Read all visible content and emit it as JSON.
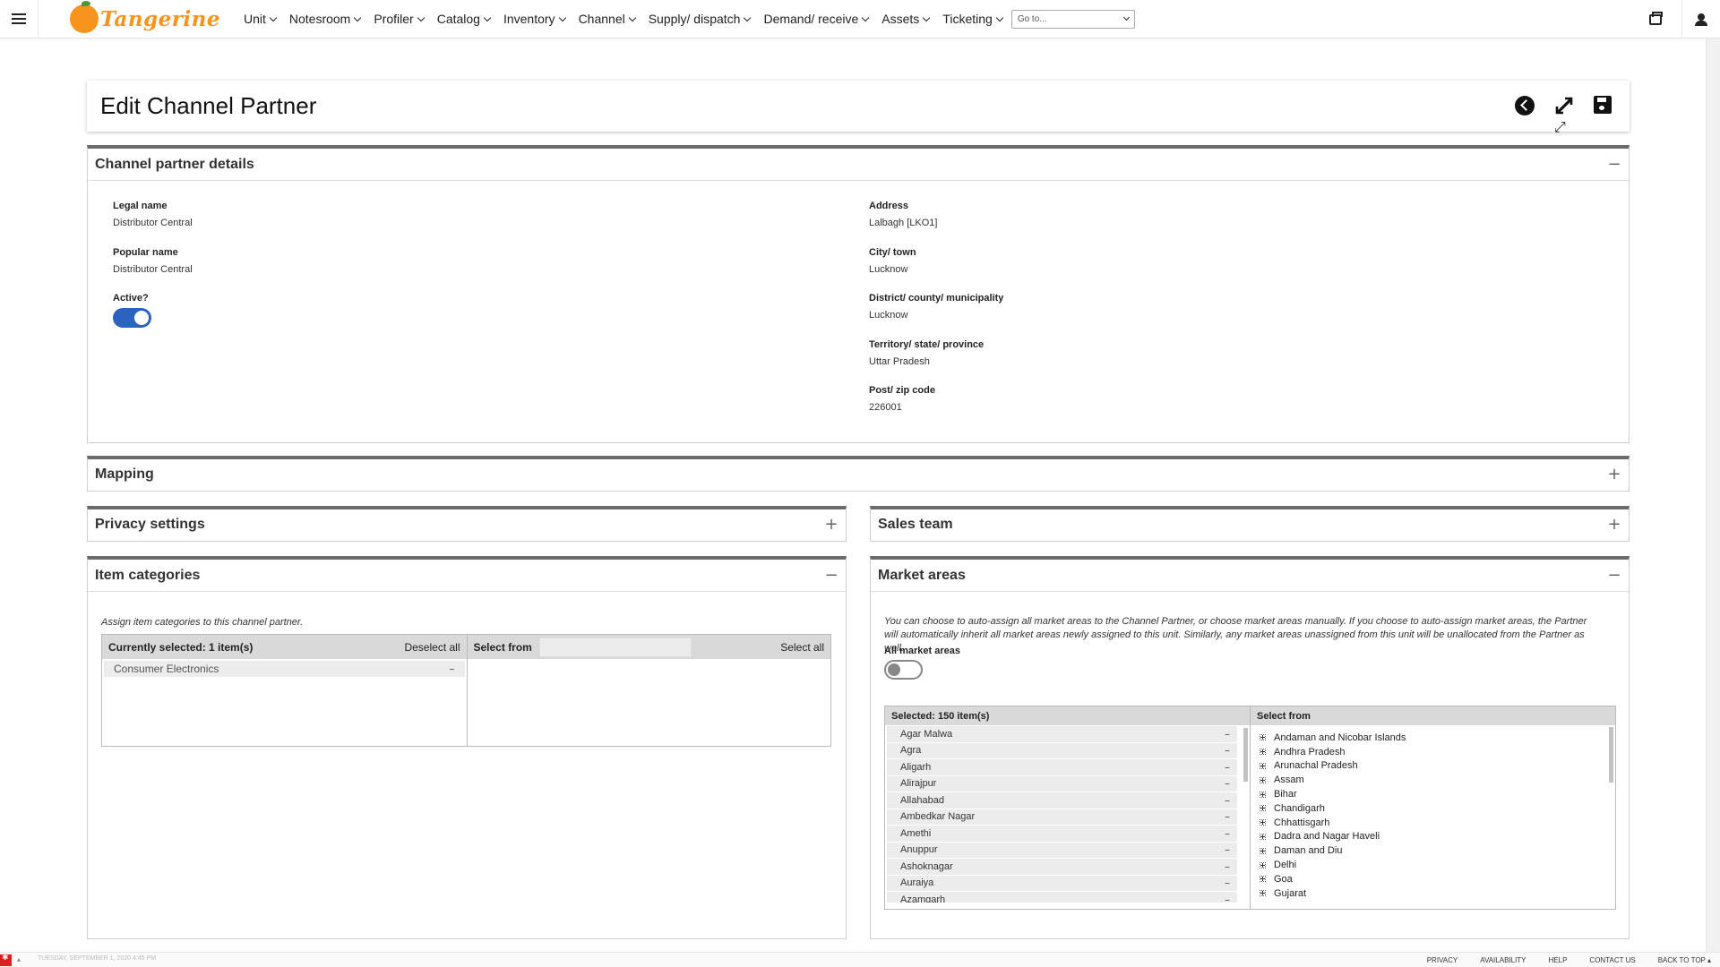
{
  "app": {
    "logo_text": "Tangerine",
    "nav": [
      "Unit",
      "Notesroom",
      "Profiler",
      "Catalog",
      "Inventory",
      "Channel",
      "Supply/ dispatch",
      "Demand/ receive",
      "Assets",
      "Ticketing"
    ],
    "goto_placeholder": "Go to...",
    "icons": {
      "menu": "hamburger-icon",
      "print": "print-icon",
      "user": "user-icon"
    }
  },
  "page": {
    "title": "Edit Channel Partner",
    "actions": [
      "back-icon",
      "expand-icon",
      "save-icon"
    ]
  },
  "details": {
    "title": "Channel partner details",
    "toggle": "−",
    "legal_name_label": "Legal name",
    "legal_name": "Distributor Central",
    "popular_name_label": "Popular name",
    "popular_name": "Distributor Central",
    "active_label": "Active?",
    "active": true,
    "address_label": "Address",
    "address": "Lalbagh [LKO1]",
    "city_label": "City/ town",
    "city": "Lucknow",
    "district_label": "District/ county/ municipality",
    "district": "Lucknow",
    "territory_label": "Territory/ state/ province",
    "territory": "Uttar Pradesh",
    "zip_label": "Post/ zip code",
    "zip": "226001"
  },
  "mapping": {
    "title": "Mapping",
    "toggle": "+"
  },
  "privacy": {
    "title": "Privacy settings",
    "toggle": "+"
  },
  "sales_team": {
    "title": "Sales team",
    "toggle": "+"
  },
  "item_categories": {
    "title": "Item categories",
    "toggle": "−",
    "hint": "Assign item categories to this channel partner.",
    "selected_header": "Currently selected: 1 item(s)",
    "deselect_all": "Deselect all",
    "select_from": "Select from",
    "select_all": "Select all",
    "selected": [
      "Consumer Electronics"
    ]
  },
  "market_areas": {
    "title": "Market areas",
    "toggle": "−",
    "hint": "You can choose to auto-assign all market areas to the Channel Partner, or choose market areas manually. If you choose to auto-assign market areas, the Partner will automatically inherit all market areas newly assigned to this unit. Similarly, any market areas unassigned from this unit will be unallocated from the Partner as well.",
    "all_label": "All market areas",
    "all_enabled": false,
    "selected_header": "Selected: 150 item(s)",
    "select_from": "Select from",
    "selected": [
      "Agar Malwa",
      "Agra",
      "Aligarh",
      "Alirajpur",
      "Allahabad",
      "Ambedkar Nagar",
      "Amethi",
      "Anuppur",
      "Ashoknagar",
      "Auraiya",
      "Azamgarh"
    ],
    "available": [
      "Andaman and Nicobar Islands",
      "Andhra Pradesh",
      "Arunachal Pradesh",
      "Assam",
      "Bihar",
      "Chandigarh",
      "Chhattisgarh",
      "Dadra and Nagar Haveli",
      "Daman and Diu",
      "Delhi",
      "Goa",
      "Gujarat"
    ]
  },
  "footer": {
    "date": "TUESDAY, SEPTEMBER 1, 2020 4:45 PM",
    "links": [
      "PRIVACY",
      "AVAILABILITY",
      "HELP",
      "CONTACT US",
      "BACK TO TOP ▴"
    ]
  }
}
